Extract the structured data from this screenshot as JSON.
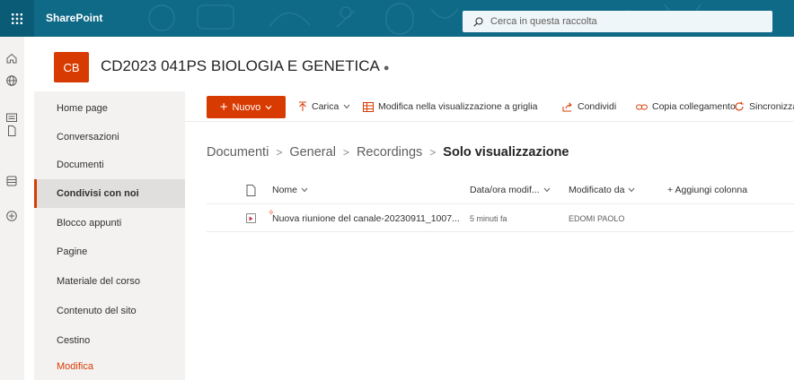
{
  "header": {
    "app_name": "SharePoint",
    "search_placeholder": "Cerca in questa raccolta"
  },
  "site": {
    "logo_initials": "CB",
    "title": "CD2023 041PS BIOLOGIA E GENETICA"
  },
  "sitenav": {
    "items": [
      {
        "label": "Home page"
      },
      {
        "label": "Conversazioni"
      },
      {
        "label": "Documenti"
      },
      {
        "label": "Condivisi con noi",
        "selected": true
      },
      {
        "label": "Blocco appunti"
      },
      {
        "label": "Pagine"
      },
      {
        "label": "Materiale del corso"
      },
      {
        "label": "Contenuto del sito"
      },
      {
        "label": "Cestino"
      },
      {
        "label": "Modifica"
      }
    ]
  },
  "commandbar": {
    "new_label": "Nuovo",
    "upload_label": "Carica",
    "grid_label": "Modifica nella visualizzazione a griglia",
    "share_label": "Condividi",
    "copylink_label": "Copia collegamento",
    "sync_label": "Sincronizza"
  },
  "breadcrumb": {
    "items": [
      "Documenti",
      "General",
      "Recordings"
    ],
    "current": "Solo visualizzazione"
  },
  "table": {
    "columns": {
      "name": "Nome",
      "modified": "Data/ora modif...",
      "modified_by": "Modificato da",
      "add_column": "+ Aggiungi colonna"
    },
    "rows": [
      {
        "name": "Nuova riunione del canale-20230911_1007...",
        "modified": "5 minuti fa",
        "modified_by": "EDOMI PAOLO"
      }
    ]
  },
  "colors": {
    "suite_bar": "#0f6a87",
    "accent": "#d83b01",
    "nav_bg": "#f3f2f1"
  }
}
